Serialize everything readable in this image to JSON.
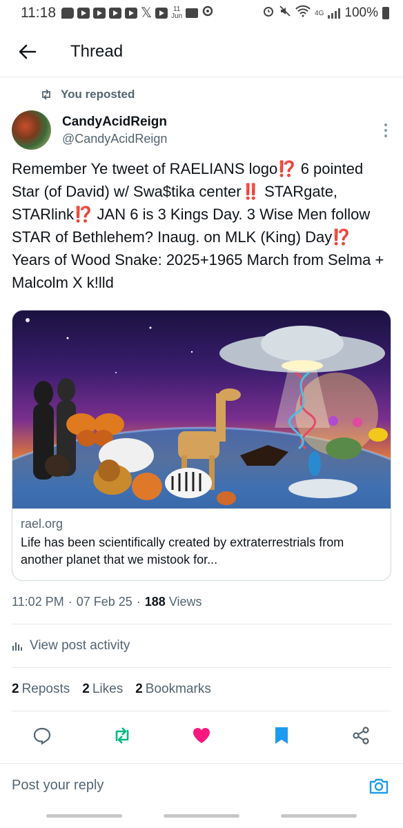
{
  "status_bar": {
    "time": "11:18",
    "date_day": "11",
    "date_month": "Jun",
    "network": "4G",
    "battery": "100%"
  },
  "header": {
    "title": "Thread"
  },
  "repost": {
    "label": "You reposted"
  },
  "author": {
    "name": "CandyAcidReign",
    "handle": "@CandyAcidReign"
  },
  "tweet": {
    "text": "Remember Ye tweet of RAELIANS logo⁉️ 6 pointed Star (of David) w/ Swa$tika center‼️ STARgate, STARlink⁉️ JAN 6 is 3 Kings Day. 3 Wise Men follow STAR of Bethlehem? Inaug. on MLK (King) Day⁉️ Years of Wood Snake: 2025+1965 March from Selma + Malcolm X k!lld"
  },
  "card": {
    "domain": "rael.org",
    "description": "Life has been scientifically created by extraterrestrials from another planet that we mistook for..."
  },
  "meta": {
    "time": "11:02 PM",
    "date": "07 Feb 25",
    "views_count": "188",
    "views_label": "Views"
  },
  "activity": {
    "label": "View post activity"
  },
  "stats": {
    "reposts_count": "2",
    "reposts_label": "Reposts",
    "likes_count": "2",
    "likes_label": "Likes",
    "bookmarks_count": "2",
    "bookmarks_label": "Bookmarks"
  },
  "reply": {
    "placeholder": "Post your reply"
  },
  "colors": {
    "repost_green": "#00ba7c",
    "like_pink": "#f91880",
    "bookmark_blue": "#1d9bf0",
    "secondary_text": "#536471"
  }
}
